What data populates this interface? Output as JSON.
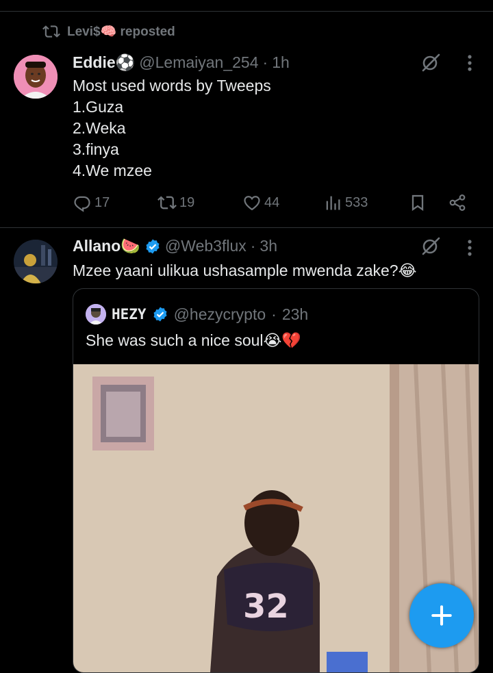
{
  "repost": {
    "text": "Levi$🧠 reposted"
  },
  "tweet1": {
    "display_name": "Eddie⚽",
    "handle": "@Lemaiyan_254",
    "separator": "·",
    "time": "1h",
    "lines": [
      "Most used words by Tweeps",
      "1.Guza",
      "2.Weka",
      "3.finya",
      "4.We mzee"
    ],
    "actions": {
      "replies": "17",
      "reposts": "19",
      "likes": "44",
      "views": "533"
    }
  },
  "tweet2": {
    "display_name": "Allano🍉",
    "handle": "@Web3flux",
    "separator": "·",
    "time": "3h",
    "text": "Mzee yaani ulikua ushasample mwenda zake?😂",
    "quote": {
      "display_name": "HEZY",
      "handle": "@hezycrypto",
      "separator": "·",
      "time": "23h",
      "text": "She was such a nice soul😭💔",
      "photo_shirt_text": "32"
    }
  },
  "colors": {
    "accent": "#1d9bf0",
    "muted": "#71767b",
    "text": "#e7e9ea",
    "divider": "#2f3336"
  },
  "icons": [
    "repost-icon",
    "grok-icon",
    "more-icon",
    "reply-icon",
    "like-icon",
    "views-icon",
    "bookmark-icon",
    "share-icon",
    "verified-badge-icon",
    "compose-plus-icon"
  ]
}
